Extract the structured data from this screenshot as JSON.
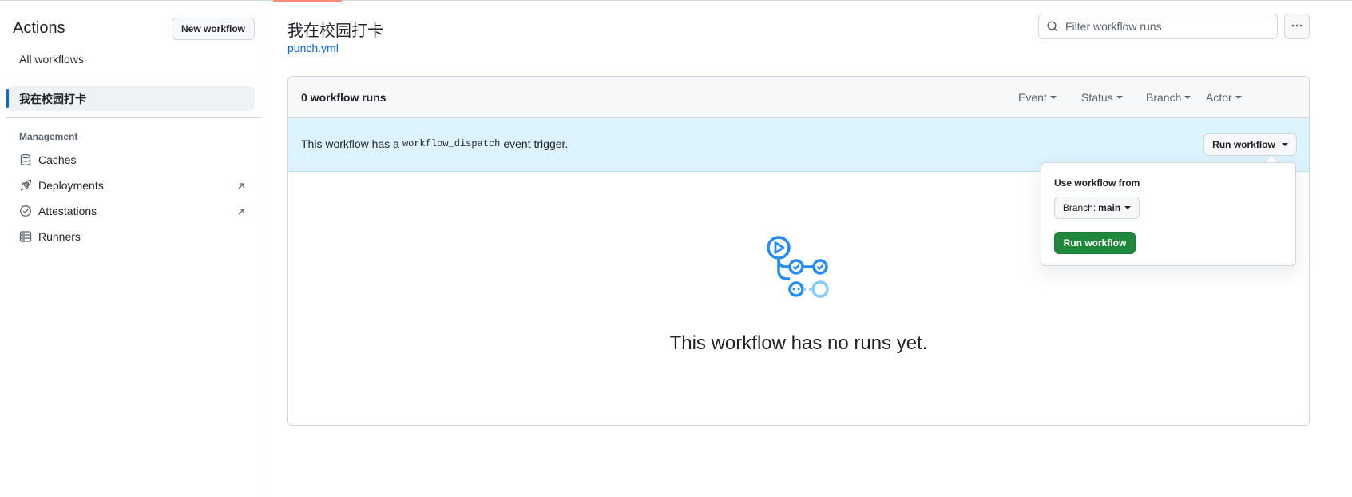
{
  "sidebar": {
    "title": "Actions",
    "new_workflow_label": "New workflow",
    "all_workflows_label": "All workflows",
    "active_workflow": "我在校园打卡",
    "management_label": "Management",
    "items": [
      {
        "label": "Caches",
        "icon": "database-icon",
        "external": false
      },
      {
        "label": "Deployments",
        "icon": "rocket-icon",
        "external": true
      },
      {
        "label": "Attestations",
        "icon": "check-circle-icon",
        "external": true
      },
      {
        "label": "Runners",
        "icon": "server-icon",
        "external": false
      }
    ]
  },
  "header": {
    "workflow_title": "我在校园打卡",
    "workflow_file": "punch.yml",
    "filter_placeholder": "Filter workflow runs"
  },
  "runs": {
    "count_label": "0 workflow runs",
    "filters": [
      "Event",
      "Status",
      "Branch",
      "Actor"
    ]
  },
  "dispatch": {
    "text_before": "This workflow has a",
    "code": "workflow_dispatch",
    "text_after": "event trigger.",
    "run_button_label": "Run workflow"
  },
  "empty_state": {
    "message": "This workflow has no runs yet."
  },
  "popover": {
    "label": "Use workflow from",
    "branch_prefix": "Branch:",
    "branch_value": "main",
    "run_button_label": "Run workflow"
  },
  "colors": {
    "accent_blue": "#0969da",
    "primary_green": "#1f883d",
    "info_bg": "#ddf4ff",
    "icon_blue": "#218bff",
    "icon_light_blue": "#80ccff"
  }
}
